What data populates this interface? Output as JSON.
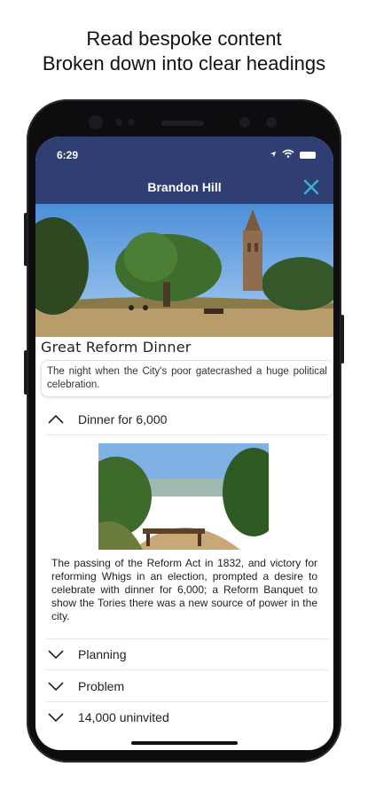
{
  "promo": {
    "line1": "Read bespoke content",
    "line2": "Broken down into clear headings"
  },
  "status_bar": {
    "time": "6:29",
    "location_icon": "location-arrow-icon",
    "wifi_icon": "wifi-icon",
    "battery_icon": "battery-icon"
  },
  "header": {
    "title": "Brandon Hill",
    "close_icon": "close-icon",
    "background": "#2f3f73",
    "accent": "#3db0d6"
  },
  "hero_image": {
    "alt": "park-with-tower"
  },
  "section": {
    "title": "Great Reform Dinner",
    "summary": "The night when the City's poor gatecrashed a huge political celebration."
  },
  "accordion": [
    {
      "label": "Dinner for 6,000",
      "expanded": true,
      "body": "The passing of the Reform Act in 1832, and victory for reforming Whigs in an election, prompted a desire to celebrate with dinner for 6,000; a Reform Banquet to show the Tories there was a new source of power in the city."
    },
    {
      "label": "Planning",
      "expanded": false
    },
    {
      "label": "Problem",
      "expanded": false
    },
    {
      "label": "14,000 uninvited",
      "expanded": false
    }
  ]
}
